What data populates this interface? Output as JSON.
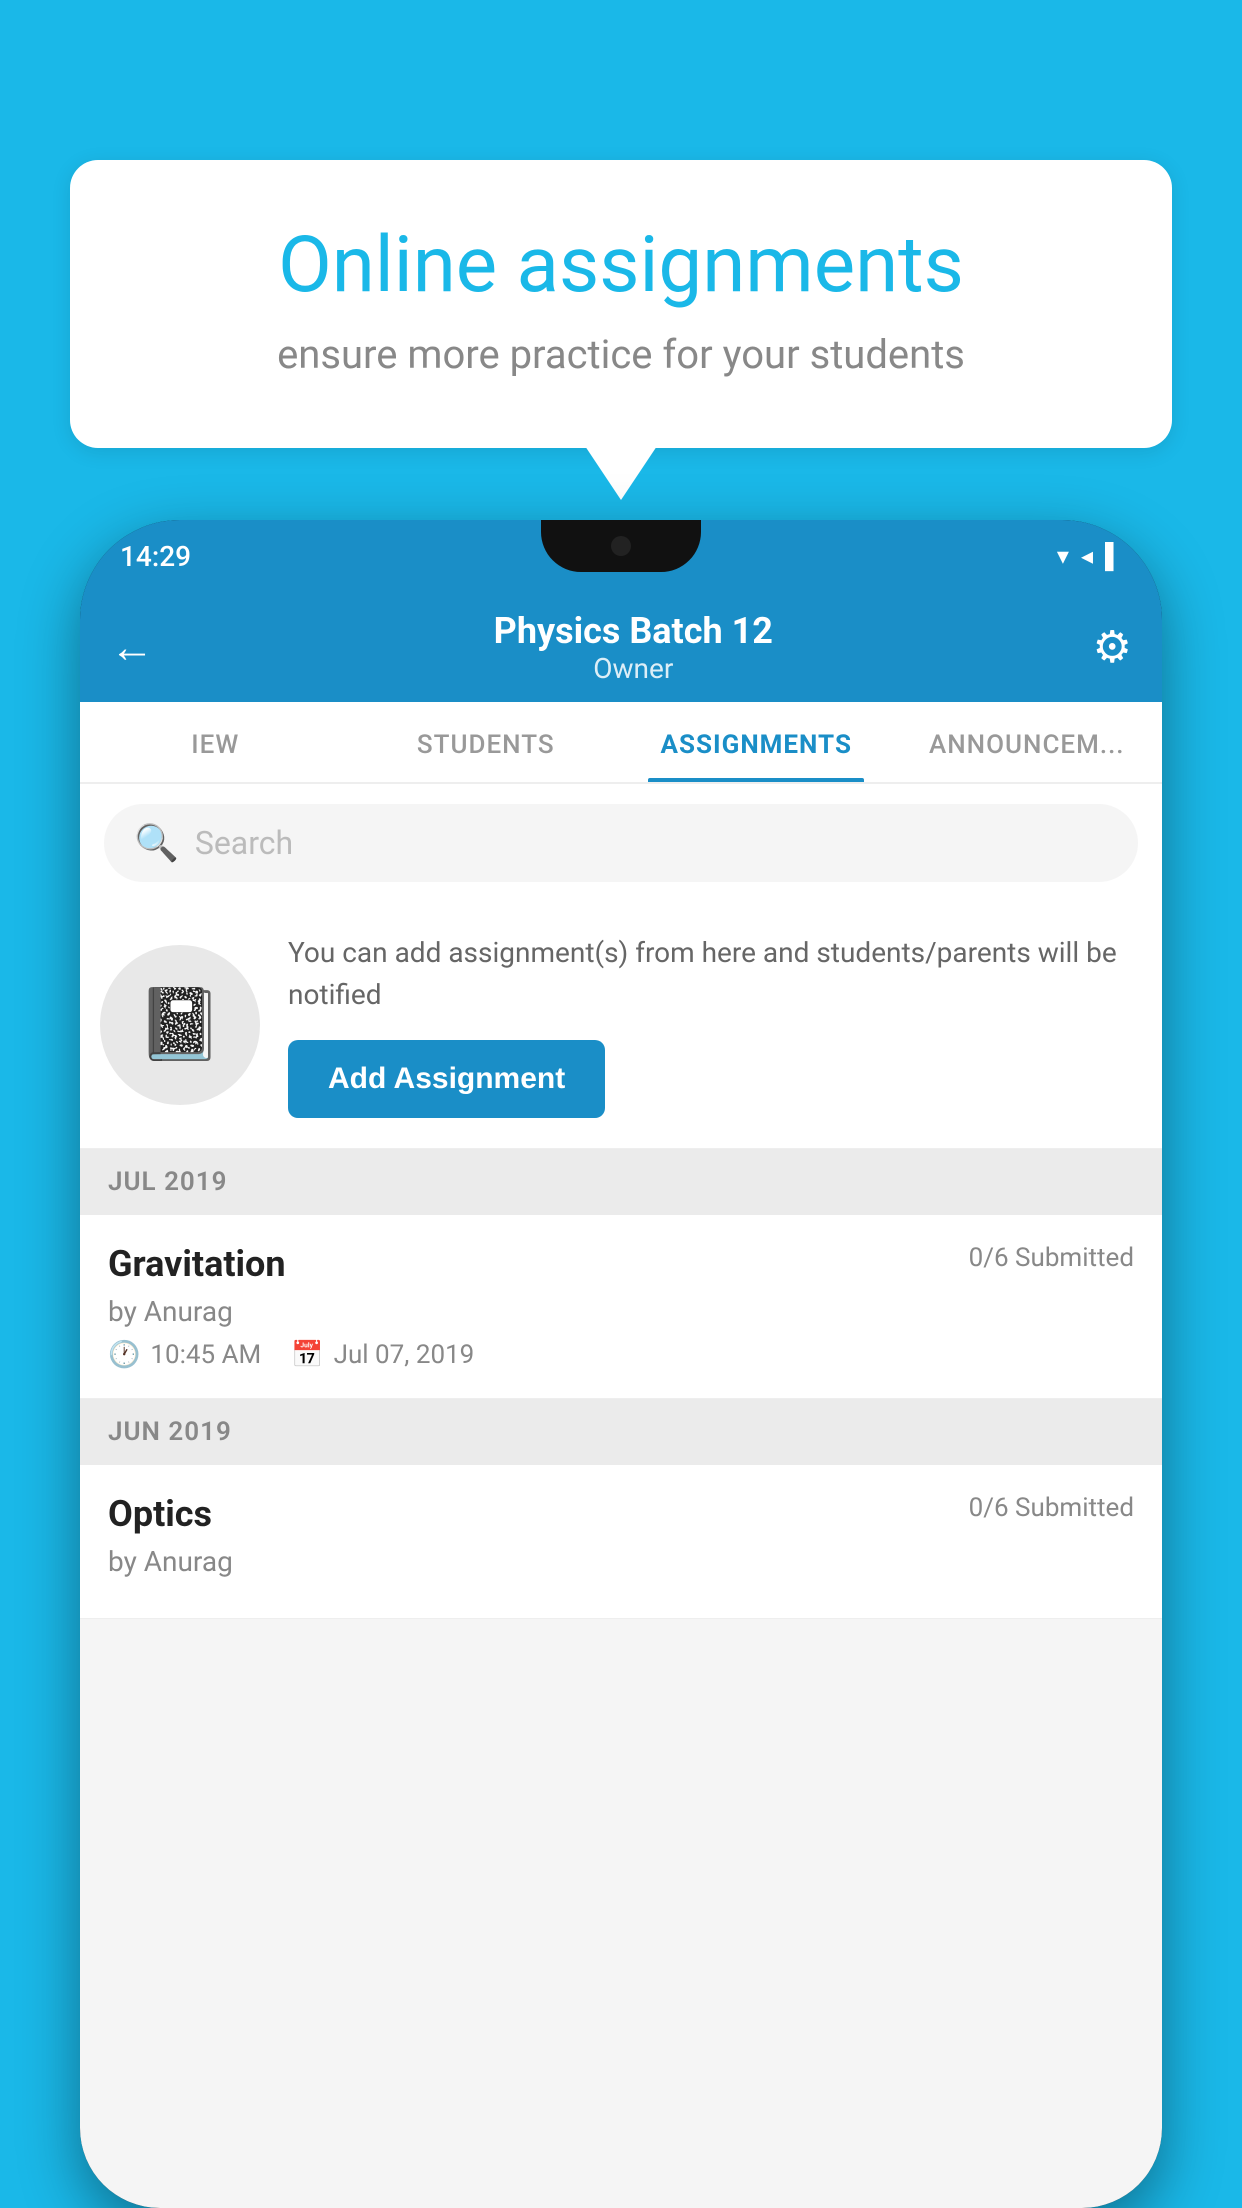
{
  "background_color": "#1ab8e8",
  "speech_bubble": {
    "title": "Online assignments",
    "subtitle": "ensure more practice for your students"
  },
  "status_bar": {
    "time": "14:29",
    "signal_icon": "▼◀▌"
  },
  "app_bar": {
    "title": "Physics Batch 12",
    "subtitle": "Owner",
    "back_label": "←",
    "gear_label": "⚙"
  },
  "tabs": [
    {
      "label": "IEW",
      "active": false
    },
    {
      "label": "STUDENTS",
      "active": false
    },
    {
      "label": "ASSIGNMENTS",
      "active": true
    },
    {
      "label": "ANNOUNCEM...",
      "active": false
    }
  ],
  "search": {
    "placeholder": "Search"
  },
  "add_assignment_section": {
    "description": "You can add assignment(s) from here and students/parents will be notified",
    "button_label": "Add Assignment"
  },
  "assignments": [
    {
      "section": "JUL 2019",
      "items": [
        {
          "name": "Gravitation",
          "submitted": "0/6 Submitted",
          "author": "by Anurag",
          "time": "10:45 AM",
          "date": "Jul 07, 2019"
        }
      ]
    },
    {
      "section": "JUN 2019",
      "items": [
        {
          "name": "Optics",
          "submitted": "0/6 Submitted",
          "author": "by Anurag",
          "time": "",
          "date": ""
        }
      ]
    }
  ]
}
